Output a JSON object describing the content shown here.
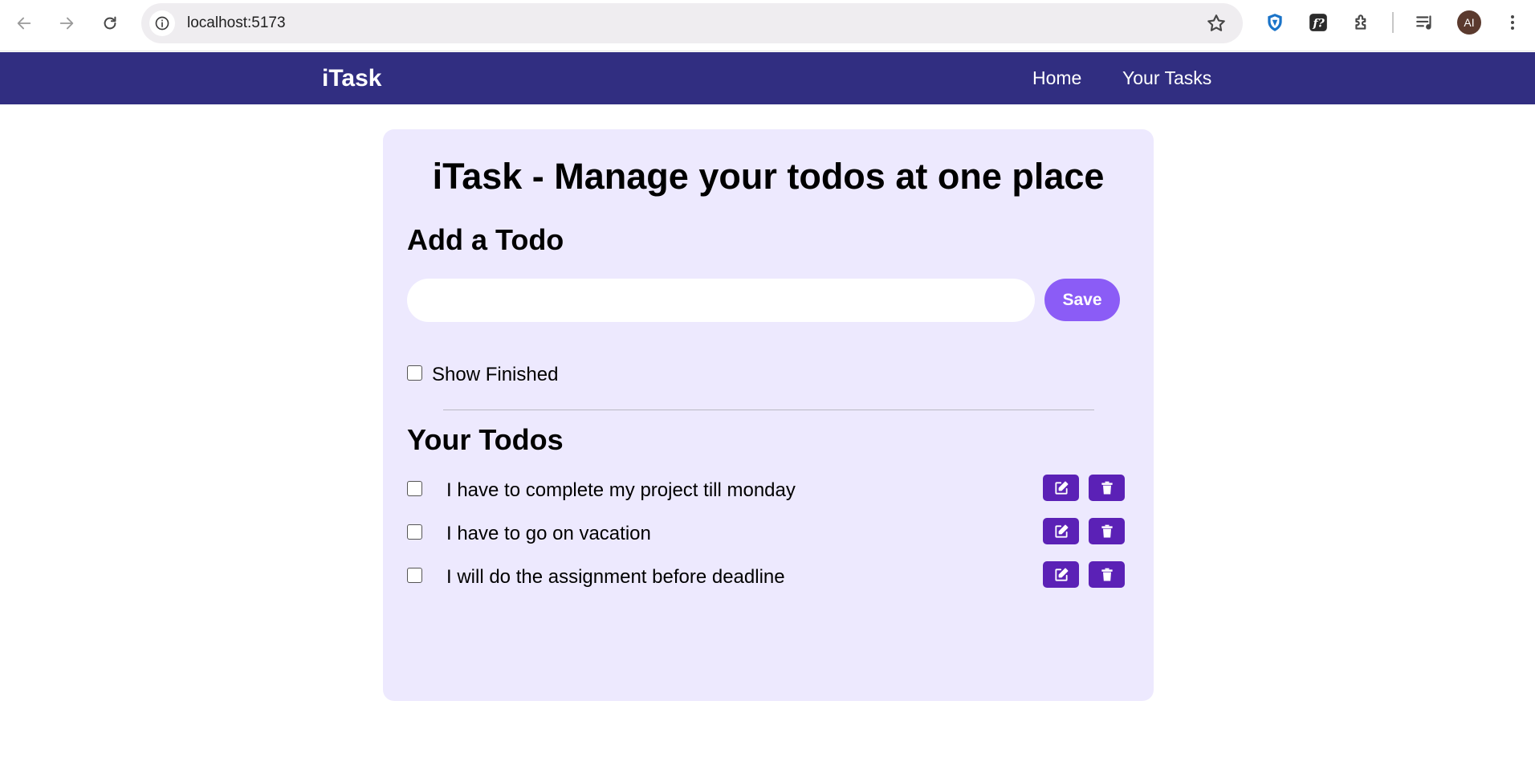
{
  "browser": {
    "url": "localhost:5173",
    "avatar_initials": "AI"
  },
  "navbar": {
    "brand": "iTask",
    "links": [
      "Home",
      "Your Tasks"
    ],
    "bg_color": "#312e81"
  },
  "main": {
    "title": "iTask - Manage your todos at one place",
    "add_section_title": "Add a Todo",
    "input_value": "",
    "save_label": "Save",
    "show_finished_label": "Show Finished",
    "show_finished_checked": false,
    "todos_section_title": "Your Todos",
    "todos": [
      {
        "text": "I have to complete my project till monday",
        "done": false
      },
      {
        "text": "I have to go on vacation",
        "done": false
      },
      {
        "text": "I will do the assignment before deadline",
        "done": false
      }
    ]
  },
  "icons": {
    "edit": "edit-icon",
    "delete": "trash-icon"
  },
  "colors": {
    "card_bg": "#ede9fe",
    "save_button": "#8b5cf6",
    "row_button": "#5b21b6"
  }
}
